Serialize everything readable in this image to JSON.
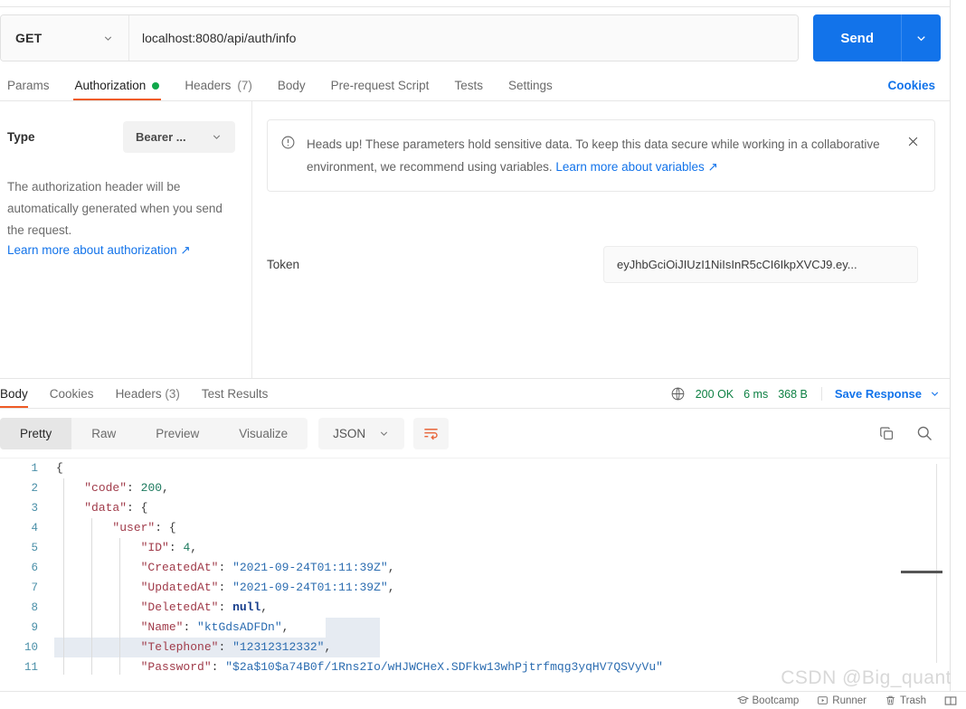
{
  "request": {
    "method": "GET",
    "url": "localhost:8080/api/auth/info",
    "send_label": "Send",
    "send_caret_icon": "chevron-down-icon",
    "method_caret_icon": "chevron-down-icon",
    "tabs": [
      {
        "label": "Params",
        "active": false,
        "dot": false
      },
      {
        "label": "Authorization",
        "active": true,
        "dot": true
      },
      {
        "label": "Headers",
        "count": "(7)",
        "active": false,
        "dot": false
      },
      {
        "label": "Body",
        "active": false,
        "dot": false
      },
      {
        "label": "Pre-request Script",
        "active": false,
        "dot": false
      },
      {
        "label": "Tests",
        "active": false,
        "dot": false
      },
      {
        "label": "Settings",
        "active": false,
        "dot": false
      }
    ],
    "cookies_link": "Cookies"
  },
  "auth": {
    "type_label": "Type",
    "type_value": "Bearer ...",
    "type_caret_icon": "chevron-down-icon",
    "description": "The authorization header will be automatically generated when you send the request.",
    "learn_more": "Learn more about authorization ↗",
    "notice": {
      "icon": "alert-circle-icon",
      "text_part1": "Heads up! These parameters hold sensitive data. To keep this data secure while working in a collaborative environment, we recommend using variables. ",
      "link": "Learn more about variables ↗",
      "close_icon": "close-icon"
    },
    "token_label": "Token",
    "token_value": "eyJhbGciOiJIUzI1NiIsInR5cCI6IkpXVCJ9.ey..."
  },
  "response": {
    "tabs": [
      {
        "label": "Body",
        "active": true
      },
      {
        "label": "Cookies",
        "active": false
      },
      {
        "label": "Headers",
        "count": "(3)",
        "active": false
      },
      {
        "label": "Test Results",
        "active": false
      }
    ],
    "globe_icon": "globe-icon",
    "status": "200 OK",
    "time": "6 ms",
    "size": "368 B",
    "save_response": "Save Response",
    "save_caret_icon": "chevron-down-icon",
    "format_tabs": [
      {
        "label": "Pretty",
        "active": true
      },
      {
        "label": "Raw",
        "active": false
      },
      {
        "label": "Preview",
        "active": false
      },
      {
        "label": "Visualize",
        "active": false
      }
    ],
    "language": "JSON",
    "language_caret_icon": "chevron-down-icon",
    "wrap_icon": "wrap-lines-icon",
    "copy_icon": "copy-icon",
    "search_icon": "search-icon",
    "body_lines": [
      {
        "n": "1",
        "indent": 0,
        "tokens": [
          {
            "t": "{",
            "c": "p"
          }
        ]
      },
      {
        "n": "2",
        "indent": 1,
        "tokens": [
          {
            "t": "\"code\"",
            "c": "k"
          },
          {
            "t": ": ",
            "c": "p"
          },
          {
            "t": "200",
            "c": "n"
          },
          {
            "t": ",",
            "c": "p"
          }
        ]
      },
      {
        "n": "3",
        "indent": 1,
        "tokens": [
          {
            "t": "\"data\"",
            "c": "k"
          },
          {
            "t": ": {",
            "c": "p"
          }
        ]
      },
      {
        "n": "4",
        "indent": 2,
        "tokens": [
          {
            "t": "\"user\"",
            "c": "k"
          },
          {
            "t": ": {",
            "c": "p"
          }
        ]
      },
      {
        "n": "5",
        "indent": 3,
        "tokens": [
          {
            "t": "\"ID\"",
            "c": "k"
          },
          {
            "t": ": ",
            "c": "p"
          },
          {
            "t": "4",
            "c": "n"
          },
          {
            "t": ",",
            "c": "p"
          }
        ]
      },
      {
        "n": "6",
        "indent": 3,
        "tokens": [
          {
            "t": "\"CreatedAt\"",
            "c": "k"
          },
          {
            "t": ": ",
            "c": "p"
          },
          {
            "t": "\"2021-09-24T01:11:39Z\"",
            "c": "s"
          },
          {
            "t": ",",
            "c": "p"
          }
        ]
      },
      {
        "n": "7",
        "indent": 3,
        "tokens": [
          {
            "t": "\"UpdatedAt\"",
            "c": "k"
          },
          {
            "t": ": ",
            "c": "p"
          },
          {
            "t": "\"2021-09-24T01:11:39Z\"",
            "c": "s"
          },
          {
            "t": ",",
            "c": "p"
          }
        ]
      },
      {
        "n": "8",
        "indent": 3,
        "tokens": [
          {
            "t": "\"DeletedAt\"",
            "c": "k"
          },
          {
            "t": ": ",
            "c": "p"
          },
          {
            "t": "null",
            "c": "nul"
          },
          {
            "t": ",",
            "c": "p"
          }
        ]
      },
      {
        "n": "9",
        "indent": 3,
        "tokens": [
          {
            "t": "\"Name\"",
            "c": "k"
          },
          {
            "t": ": ",
            "c": "p"
          },
          {
            "t": "\"ktGdsADFDn\"",
            "c": "s"
          },
          {
            "t": ",",
            "c": "p"
          }
        ]
      },
      {
        "n": "10",
        "indent": 3,
        "highlight": true,
        "tokens": [
          {
            "t": "\"Telephone\"",
            "c": "k"
          },
          {
            "t": ": ",
            "c": "p"
          },
          {
            "t": "\"12312312332\"",
            "c": "s"
          },
          {
            "t": ",",
            "c": "p"
          }
        ]
      },
      {
        "n": "11",
        "indent": 3,
        "tokens": [
          {
            "t": "\"Password\"",
            "c": "k"
          },
          {
            "t": ": ",
            "c": "p"
          },
          {
            "t": "\"$2a$10$a74B0f/1Rns2Io/wHJWCHeX.SDFkw13whPjtrfmqg3yqHV7QSVyVu\"",
            "c": "s"
          }
        ]
      }
    ]
  },
  "bottom_bar": {
    "items": [
      {
        "icon": "graduation-cap-icon",
        "label": "Bootcamp"
      },
      {
        "icon": "play-box-icon",
        "label": "Runner"
      },
      {
        "icon": "trash-icon",
        "label": "Trash"
      }
    ],
    "layout_icon": "two-pane-layout-icon"
  },
  "watermark": "CSDN @Big_quant"
}
